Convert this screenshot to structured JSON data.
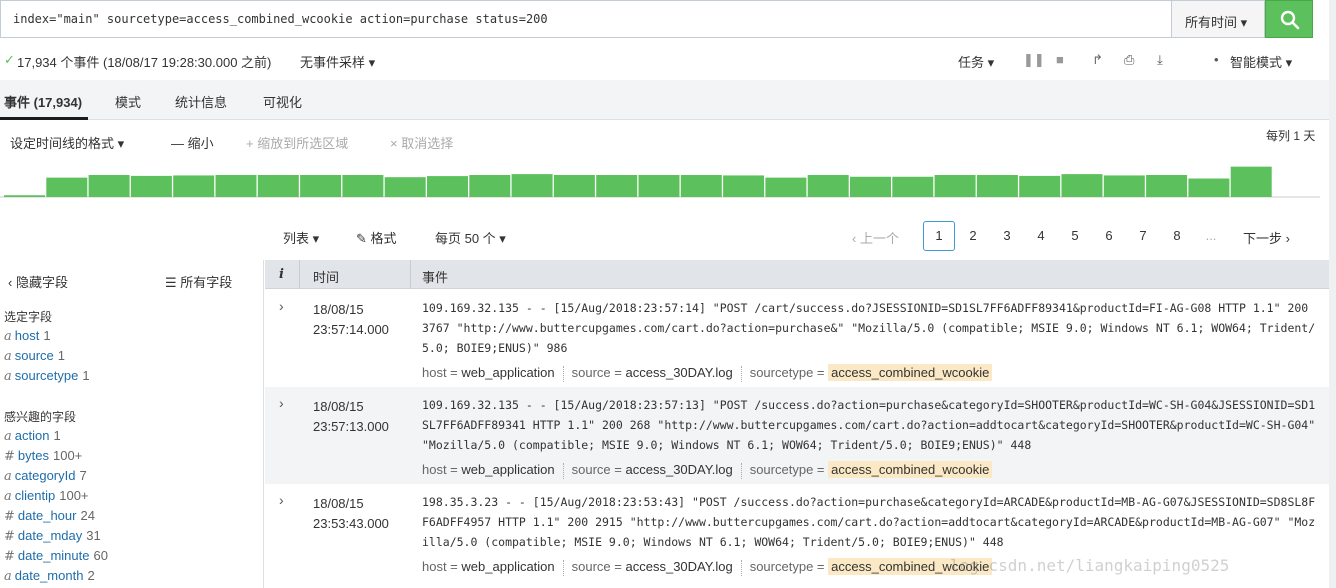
{
  "search": {
    "query": "index=\"main\" sourcetype=access_combined_wcookie action=purchase status=200",
    "time_range": "所有时间 ▾"
  },
  "status": {
    "event_count": "17,934 个事件 (18/08/17 19:28:30.000 之前)",
    "sampling": "无事件采样 ▾",
    "jobs": "任务 ▾",
    "mode": "智能模式 ▾"
  },
  "tabs": [
    {
      "label": "事件 (17,934)",
      "active": true
    },
    {
      "label": "模式"
    },
    {
      "label": "统计信息"
    },
    {
      "label": "可视化"
    }
  ],
  "timeline": {
    "format": "设定时间线的格式 ▾",
    "zoom_out": "— 缩小",
    "zoom_to_selection": "+ 缩放到所选区域",
    "deselect": "× 取消选择",
    "scale": "每列 1 天",
    "bar_color": "#5cc05c",
    "levels": [
      0.08,
      0.88,
      1.0,
      0.96,
      0.98,
      1.0,
      1.0,
      1.0,
      1.0,
      0.9,
      0.95,
      1.0,
      1.04,
      1.0,
      1.0,
      1.0,
      1.0,
      0.98,
      0.88,
      1.0,
      0.92,
      0.92,
      1.0,
      1.0,
      0.96,
      1.04,
      0.98,
      1.0,
      0.84,
      1.38
    ]
  },
  "results": {
    "list": "列表 ▾",
    "format": "✎ 格式",
    "per_page": "每页 50 个 ▾",
    "prev": "‹ 上一个",
    "pages": [
      "1",
      "2",
      "3",
      "4",
      "5",
      "6",
      "7",
      "8",
      "..."
    ],
    "next": "下一步 ›"
  },
  "sidebar": {
    "hide_fields": "‹ 隐藏字段",
    "all_fields": "☰ 所有字段",
    "selected_title": "选定字段",
    "selected": [
      {
        "type": "a",
        "name": "host",
        "count": "1"
      },
      {
        "type": "a",
        "name": "source",
        "count": "1"
      },
      {
        "type": "a",
        "name": "sourcetype",
        "count": "1"
      }
    ],
    "interesting_title": "感兴趣的字段",
    "interesting": [
      {
        "type": "a",
        "name": "action",
        "count": "1"
      },
      {
        "type": "#",
        "name": "bytes",
        "count": "100+"
      },
      {
        "type": "a",
        "name": "categoryId",
        "count": "7"
      },
      {
        "type": "a",
        "name": "clientip",
        "count": "100+"
      },
      {
        "type": "#",
        "name": "date_hour",
        "count": "24"
      },
      {
        "type": "#",
        "name": "date_mday",
        "count": "31"
      },
      {
        "type": "#",
        "name": "date_minute",
        "count": "60"
      },
      {
        "type": "a",
        "name": "date_month",
        "count": "2"
      }
    ]
  },
  "events": {
    "headers": {
      "info": "i",
      "time": "时间",
      "event": "事件"
    },
    "rows": [
      {
        "date": "18/08/15",
        "time": "23:57:14.000",
        "raw": "109.169.32.135 - - [15/Aug/2018:23:57:14] \"POST /cart/success.do?JSESSIONID=SD1SL7FF6ADFF89341&productId=FI-AG-G08 HTTP 1.1\" 200 3767 \"http://www.buttercupgames.com/cart.do?action=purchase&\" \"Mozilla/5.0 (compatible; MSIE 9.0; Windows NT 6.1; WOW64; Trident/5.0; BOIE9;ENUS)\" 986",
        "host_key": "host =",
        "host": "web_application",
        "source_key": "source =",
        "source": "access_30DAY.log",
        "sourcetype_key": "sourcetype =",
        "sourcetype": "access_combined_wcookie"
      },
      {
        "date": "18/08/15",
        "time": "23:57:13.000",
        "raw": "109.169.32.135 - - [15/Aug/2018:23:57:13] \"POST /success.do?action=purchase&categoryId=SHOOTER&productId=WC-SH-G04&JSESSIONID=SD1SL7FF6ADFF89341 HTTP 1.1\" 200 268 \"http://www.buttercupgames.com/cart.do?action=addtocart&categoryId=SHOOTER&productId=WC-SH-G04\" \"Mozilla/5.0 (compatible; MSIE 9.0; Windows NT 6.1; WOW64; Trident/5.0; BOIE9;ENUS)\" 448",
        "host_key": "host =",
        "host": "web_application",
        "source_key": "source =",
        "source": "access_30DAY.log",
        "sourcetype_key": "sourcetype =",
        "sourcetype": "access_combined_wcookie"
      },
      {
        "date": "18/08/15",
        "time": "23:53:43.000",
        "raw": "198.35.3.23 - - [15/Aug/2018:23:53:43] \"POST /success.do?action=purchase&categoryId=ARCADE&productId=MB-AG-G07&JSESSIONID=SD8SL8FF6ADFF4957 HTTP 1.1\" 200 2915 \"http://www.buttercupgames.com/cart.do?action=addtocart&categoryId=ARCADE&productId=MB-AG-G07\" \"Mozilla/5.0 (compatible; MSIE 9.0; Windows NT 6.1; WOW64; Trident/5.0; BOIE9;ENUS)\" 448",
        "host_key": "host =",
        "host": "web_application",
        "source_key": "source =",
        "source": "access_30DAY.log",
        "sourcetype_key": "sourcetype =",
        "sourcetype": "access_combined_wcookie"
      }
    ]
  },
  "watermark": "log.csdn.net/liangkaiping0525"
}
